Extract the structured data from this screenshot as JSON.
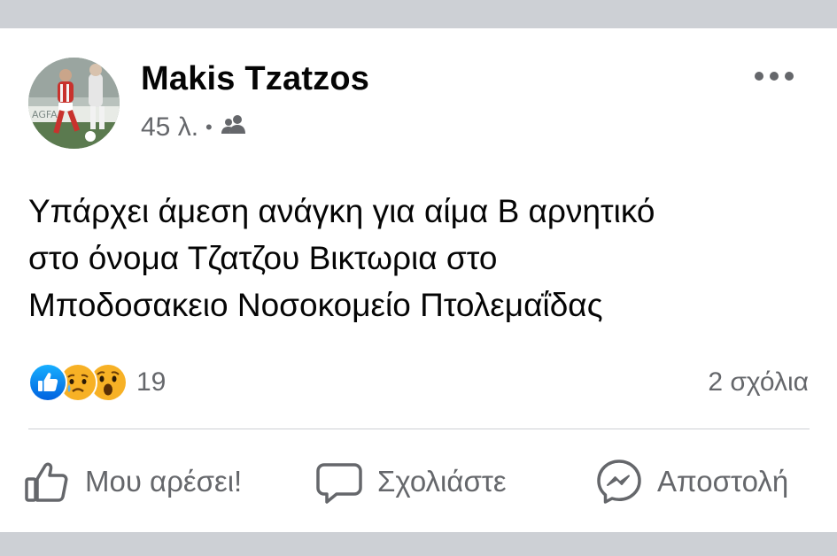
{
  "post": {
    "author": "Makis Tzatzos",
    "time": "45 λ.",
    "separator": "•",
    "audience_icon": "friends-icon",
    "more_icon": "more-options-icon",
    "text_lines": [
      "Υπάρχει άμεση ανάγκη για αίμα Β αρνητικό",
      "στο όνομα Τζατζου Βικτωρια στο",
      "Μποδοσακειο Νοσοκομείο Πτολεμαΐδας"
    ],
    "avatar_banner_text": "AGFA"
  },
  "reactions": {
    "types": [
      "like-reaction-icon",
      "sad-reaction-icon",
      "wow-reaction-icon"
    ],
    "count": "19"
  },
  "comments_count": "2 σχόλια",
  "actions": {
    "like": "Μου αρέσει!",
    "comment": "Σχολιάστε",
    "send": "Αποστολή"
  },
  "colors": {
    "like_blue": "#1877f2",
    "secondary_text": "#65676b",
    "primary_text": "#050505",
    "band_gray": "#cdd0d5"
  }
}
